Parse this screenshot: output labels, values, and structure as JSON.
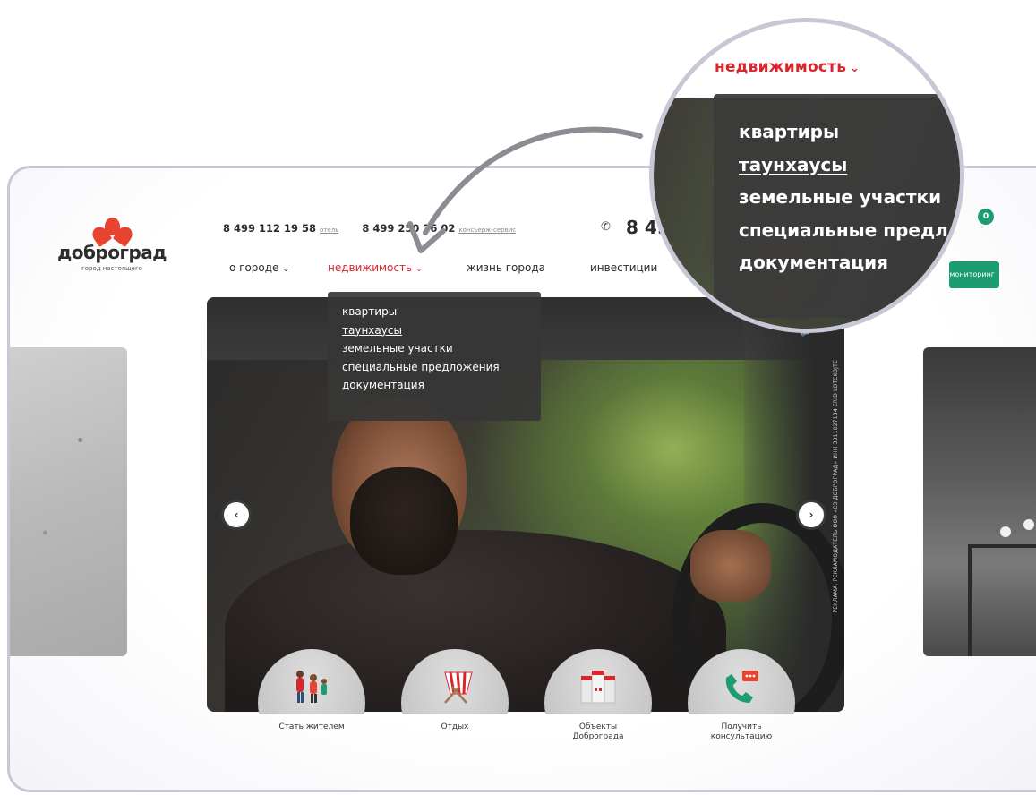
{
  "logo": {
    "wordmark": "доброград",
    "tagline": "город настоящего"
  },
  "header": {
    "phones": [
      {
        "number": "8 499 112 19 58",
        "tag": "отель"
      },
      {
        "number": "8 499 250 26 02",
        "tag": "консьерж-сервис"
      }
    ],
    "main_phone": "8 49",
    "cart_count": "0",
    "monitoring_label": "мониторинг"
  },
  "nav": {
    "items": [
      {
        "label": "о городе",
        "chevron": "chevron-down-icon"
      },
      {
        "label": "недвижимость",
        "chevron": "chevron-down-icon",
        "active": true
      },
      {
        "label": "жизнь города"
      },
      {
        "label": "инвестиции"
      }
    ]
  },
  "dropdown": {
    "items": [
      {
        "label": "квартиры"
      },
      {
        "label": "таунхаусы",
        "underlined": true
      },
      {
        "label": "земельные участки"
      },
      {
        "label": "специальные предложения"
      },
      {
        "label": "документация"
      }
    ]
  },
  "magnifier": {
    "title": "недвижимость",
    "items": [
      {
        "label": "квартиры"
      },
      {
        "label": "таунхаусы",
        "underlined": true
      },
      {
        "label": "земельные участки"
      },
      {
        "label": "специальные предл"
      },
      {
        "label": "документация"
      }
    ]
  },
  "hero": {
    "disclaimer": "РЕКЛАМА. РЕКЛАМОДАТЕЛЬ ООО «СЗ ДОБРОГРАД» ИНН 3311027134 ERID LDTCKOJTE"
  },
  "tiles": [
    {
      "label": "Стать жителем",
      "icon": "family-icon"
    },
    {
      "label": "Отдых",
      "icon": "deckchair-icon"
    },
    {
      "label": "Объекты\nДоброграда",
      "icon": "buildings-icon"
    },
    {
      "label": "Получить\nконсультацию",
      "icon": "phone-call-icon"
    }
  ],
  "colors": {
    "accent": "#d8262e",
    "brand_green": "#1d9b72",
    "logo_red": "#e8432e",
    "frame": "#c9c6d6"
  }
}
